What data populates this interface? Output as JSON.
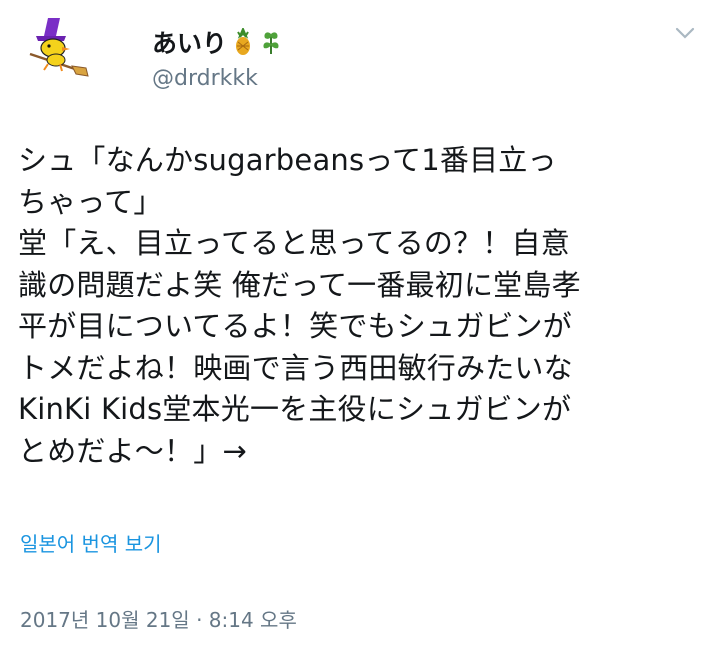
{
  "author": {
    "display_name": "あいり",
    "emojis": [
      "pineapple-icon",
      "herb-icon"
    ],
    "handle": "@drdrkkk"
  },
  "tweet": {
    "text": "シュ「なんかsugarbeansって1番目立っ\nちゃって」\n堂「え、目立ってると思ってるの？！自意\n識の問題だよ笑 俺だって一番最初に堂島孝\n平が目についてるよ！笑でもシュガビンが\nトメだよね！映画で言う西田敏行みたいな\nKinKi Kids堂本光一を主役にシュガビンが\nとめだよ〜！」→"
  },
  "translate_link": "일본어 번역 보기",
  "timestamp": "2017년 10월 21일 · 8:14 오후",
  "colors": {
    "link": "#1b95e0",
    "secondary_text": "#657786",
    "primary_text": "#14171a"
  }
}
